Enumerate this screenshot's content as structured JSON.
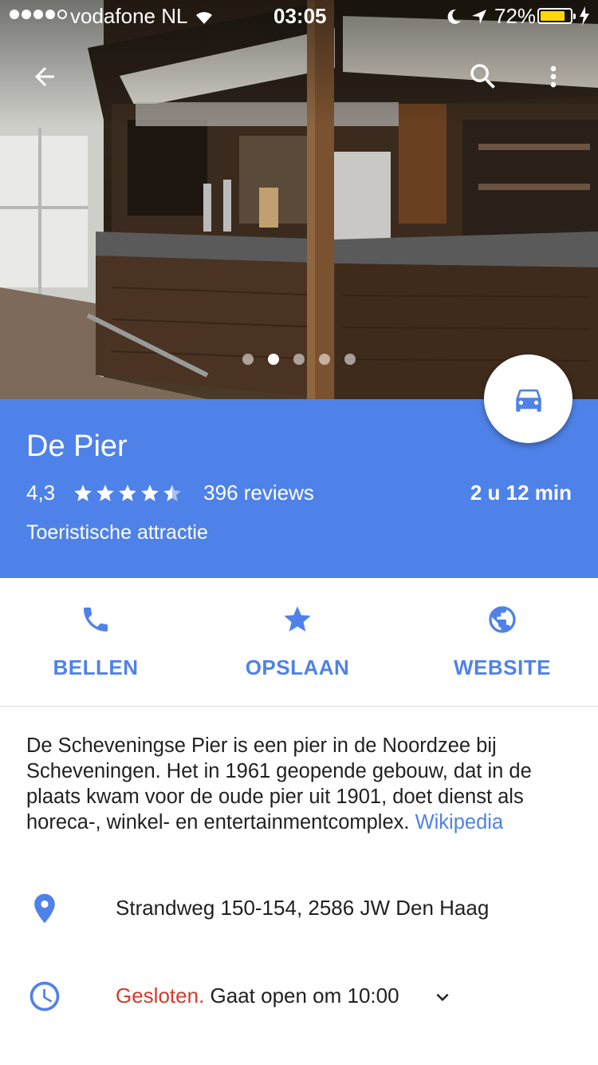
{
  "status_bar": {
    "carrier": "vodafone NL",
    "time": "03:05",
    "battery": "72%"
  },
  "hero": {
    "photo_count": 5,
    "active_photo_index": 1
  },
  "place": {
    "name": "De Pier",
    "rating": "4,3",
    "rating_value": 4.3,
    "reviews": "396 reviews",
    "travel_time": "2 u 12 min",
    "category": "Toeristische attractie"
  },
  "actions": {
    "call": "BELLEN",
    "save": "OPSLAAN",
    "website": "WEBSITE"
  },
  "description": {
    "text": "De Scheveningse Pier is een pier in de Noordzee bij Scheveningen. Het in 1961 geopende gebouw, dat in de plaats kwam voor de oude pier uit 1901, doet dienst als horeca-, winkel- en entertainmentcomplex. ",
    "link": "Wikipedia"
  },
  "info": {
    "address": "Strandweg 150-154, 2586 JW Den Haag",
    "status": "Gesloten.",
    "hours": " Gaat open om 10:00"
  },
  "icons": {
    "back": "arrow-left-icon",
    "search": "search-icon",
    "more": "more-vert-icon",
    "directions": "car-icon",
    "call": "phone-icon",
    "save": "star-icon",
    "website": "globe-icon",
    "address": "location-pin-icon",
    "hours": "clock-icon",
    "expand": "chevron-down-icon"
  },
  "colors": {
    "accent": "#4f82e8",
    "closed": "#d33b2c",
    "battery": "#ffd60a"
  }
}
